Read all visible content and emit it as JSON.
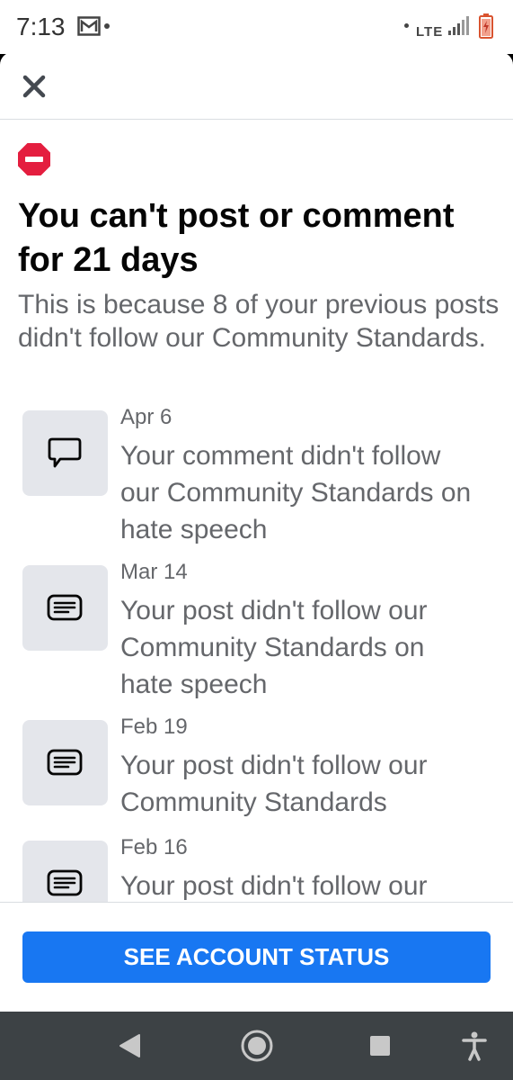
{
  "status_bar": {
    "time": "7:13",
    "network": "LTE",
    "icons": [
      "gmail-icon",
      "notification-dot-icon",
      "signal-icon",
      "battery-icon"
    ]
  },
  "dialog": {
    "close_icon": "close-icon",
    "alert_icon": "blocked-icon",
    "alert_color": "#e41e3f",
    "title": "You can't post or comment for 21 days",
    "subtitle": "This is because 8 of your previous posts didn't follow our Community Standards.",
    "violations": [
      {
        "date": "Apr 6",
        "text": "Your comment didn't follow our Community Standards on hate speech",
        "icon": "comment-icon"
      },
      {
        "date": "Mar 14",
        "text": "Your post didn't follow our Community Standards on hate speech",
        "icon": "post-icon"
      },
      {
        "date": "Feb 19",
        "text": "Your post didn't follow our Community Standards",
        "icon": "post-icon"
      },
      {
        "date": "Feb 16",
        "text": "Your post didn't follow our",
        "icon": "post-icon"
      }
    ],
    "button_label": "SEE ACCOUNT STATUS",
    "button_color": "#1877f2"
  },
  "nav_bar": {
    "icons": [
      "back-icon",
      "home-icon",
      "recents-icon",
      "accessibility-icon"
    ]
  }
}
